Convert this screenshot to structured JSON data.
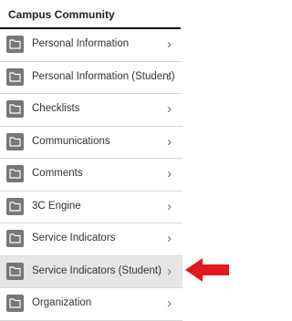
{
  "header": {
    "title": "Campus Community"
  },
  "menu": {
    "items": [
      {
        "label": "Personal Information",
        "selected": false
      },
      {
        "label": "Personal Information (Student)",
        "selected": false
      },
      {
        "label": "Checklists",
        "selected": false
      },
      {
        "label": "Communications",
        "selected": false
      },
      {
        "label": "Comments",
        "selected": false
      },
      {
        "label": "3C Engine",
        "selected": false
      },
      {
        "label": "Service Indicators",
        "selected": false
      },
      {
        "label": "Service Indicators (Student)",
        "selected": true
      },
      {
        "label": "Organization",
        "selected": false
      }
    ],
    "chevron": "›",
    "folder_icon": "folder-icon"
  },
  "annotation": {
    "arrow_color": "#e0191c",
    "arrow_direction": "left"
  }
}
